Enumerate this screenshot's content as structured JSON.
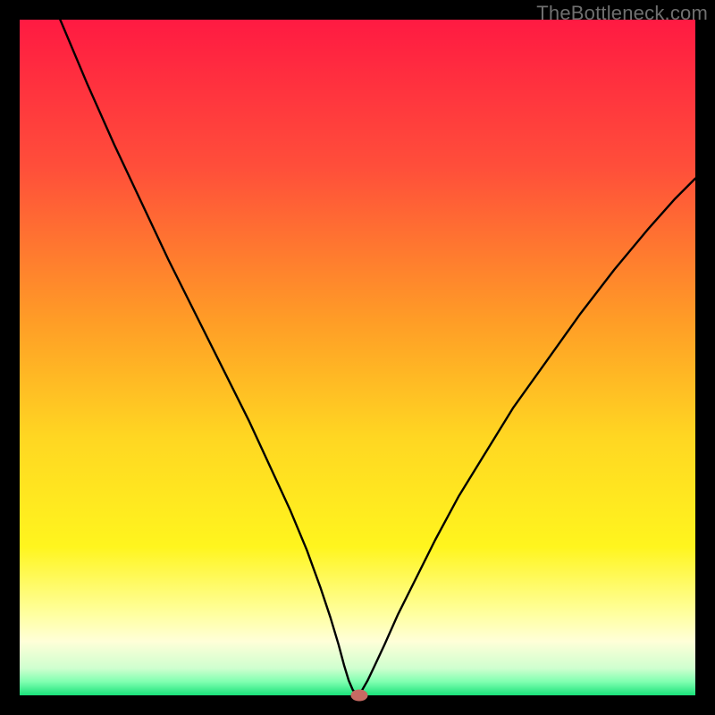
{
  "watermark": {
    "text": "TheBottleneck.com"
  },
  "chart_data": {
    "type": "line",
    "title": "",
    "xlabel": "",
    "ylabel": "",
    "xlim": [
      0,
      100
    ],
    "ylim": [
      0,
      100
    ],
    "grid": false,
    "legend": false,
    "background_gradient": {
      "stops": [
        {
          "pct": 0,
          "color": "#ff1a42"
        },
        {
          "pct": 22,
          "color": "#ff4f3a"
        },
        {
          "pct": 45,
          "color": "#ff9e26"
        },
        {
          "pct": 62,
          "color": "#ffd722"
        },
        {
          "pct": 78,
          "color": "#fff51e"
        },
        {
          "pct": 88,
          "color": "#ffffa0"
        },
        {
          "pct": 92,
          "color": "#ffffd8"
        },
        {
          "pct": 96,
          "color": "#cfffcf"
        },
        {
          "pct": 98,
          "color": "#7fffb0"
        },
        {
          "pct": 100,
          "color": "#19e27a"
        }
      ]
    },
    "curve_color": "#000000",
    "curve_width": 2.4,
    "curve_points": [
      {
        "x": 6.0,
        "y": 100.0
      },
      {
        "x": 10.0,
        "y": 90.5
      },
      {
        "x": 14.0,
        "y": 81.5
      },
      {
        "x": 18.0,
        "y": 73.0
      },
      {
        "x": 22.0,
        "y": 64.5
      },
      {
        "x": 26.0,
        "y": 56.5
      },
      {
        "x": 30.0,
        "y": 48.5
      },
      {
        "x": 34.0,
        "y": 40.5
      },
      {
        "x": 37.0,
        "y": 34.0
      },
      {
        "x": 40.0,
        "y": 27.5
      },
      {
        "x": 42.5,
        "y": 21.5
      },
      {
        "x": 44.5,
        "y": 16.0
      },
      {
        "x": 46.0,
        "y": 11.5
      },
      {
        "x": 47.2,
        "y": 7.5
      },
      {
        "x": 48.0,
        "y": 4.5
      },
      {
        "x": 48.7,
        "y": 2.2
      },
      {
        "x": 49.3,
        "y": 0.8
      },
      {
        "x": 50.0,
        "y": 0.0
      },
      {
        "x": 50.7,
        "y": 0.8
      },
      {
        "x": 51.5,
        "y": 2.2
      },
      {
        "x": 52.5,
        "y": 4.3
      },
      {
        "x": 54.0,
        "y": 7.5
      },
      {
        "x": 56.0,
        "y": 12.0
      },
      {
        "x": 58.5,
        "y": 17.0
      },
      {
        "x": 61.5,
        "y": 23.0
      },
      {
        "x": 65.0,
        "y": 29.5
      },
      {
        "x": 69.0,
        "y": 36.0
      },
      {
        "x": 73.0,
        "y": 42.5
      },
      {
        "x": 78.0,
        "y": 49.5
      },
      {
        "x": 83.0,
        "y": 56.5
      },
      {
        "x": 88.0,
        "y": 63.0
      },
      {
        "x": 93.0,
        "y": 69.0
      },
      {
        "x": 97.0,
        "y": 73.5
      },
      {
        "x": 100.0,
        "y": 76.5
      }
    ],
    "marker": {
      "x": 50.3,
      "y": 0.0,
      "color": "#c76a63"
    }
  }
}
